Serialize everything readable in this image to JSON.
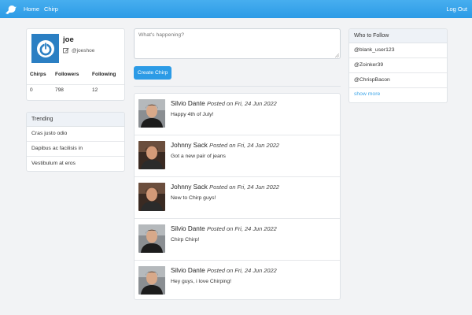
{
  "nav": {
    "home": "Home",
    "chirp": "Chirp",
    "logout": "Log Out"
  },
  "profile": {
    "username": "joe",
    "handle": "@joeshoe",
    "stats_labels": [
      "Chirps",
      "Followers",
      "Following"
    ],
    "stats_values": [
      "0",
      "798",
      "12"
    ]
  },
  "trending": {
    "title": "Trending",
    "items": [
      "Cras justo odio",
      "Dapibus ac facilisis in",
      "Vestibulum at eros"
    ]
  },
  "compose": {
    "placeholder": "What's happening?",
    "button": "Create Chirp"
  },
  "posts": [
    {
      "name": "Silvio Dante",
      "meta": "Posted on Fri, 24 Jun 2022",
      "body": "Happy 4th of July!"
    },
    {
      "name": "Johnny Sack",
      "meta": "Posted on Fri, 24 Jun 2022",
      "body": "Got a new pair of jeans"
    },
    {
      "name": "Johnny Sack",
      "meta": "Posted on Fri, 24 Jun 2022",
      "body": "New to Chirp guys!"
    },
    {
      "name": "Silvio Dante",
      "meta": "Posted on Fri, 24 Jun 2022",
      "body": "Chirp Chirp!"
    },
    {
      "name": "Silvio Dante",
      "meta": "Posted on Fri, 24 Jun 2022",
      "body": "Hey guys, i love Chirping!"
    }
  ],
  "who": {
    "title": "Who to Follow",
    "items": [
      "@blank_user123",
      "@Zoinker39",
      "@ChrispBacon"
    ],
    "show_more": "show more"
  },
  "colors": {
    "accent": "#2c9be6",
    "avatar_bg": "#2b7fc3",
    "link": "#3da5e8"
  }
}
